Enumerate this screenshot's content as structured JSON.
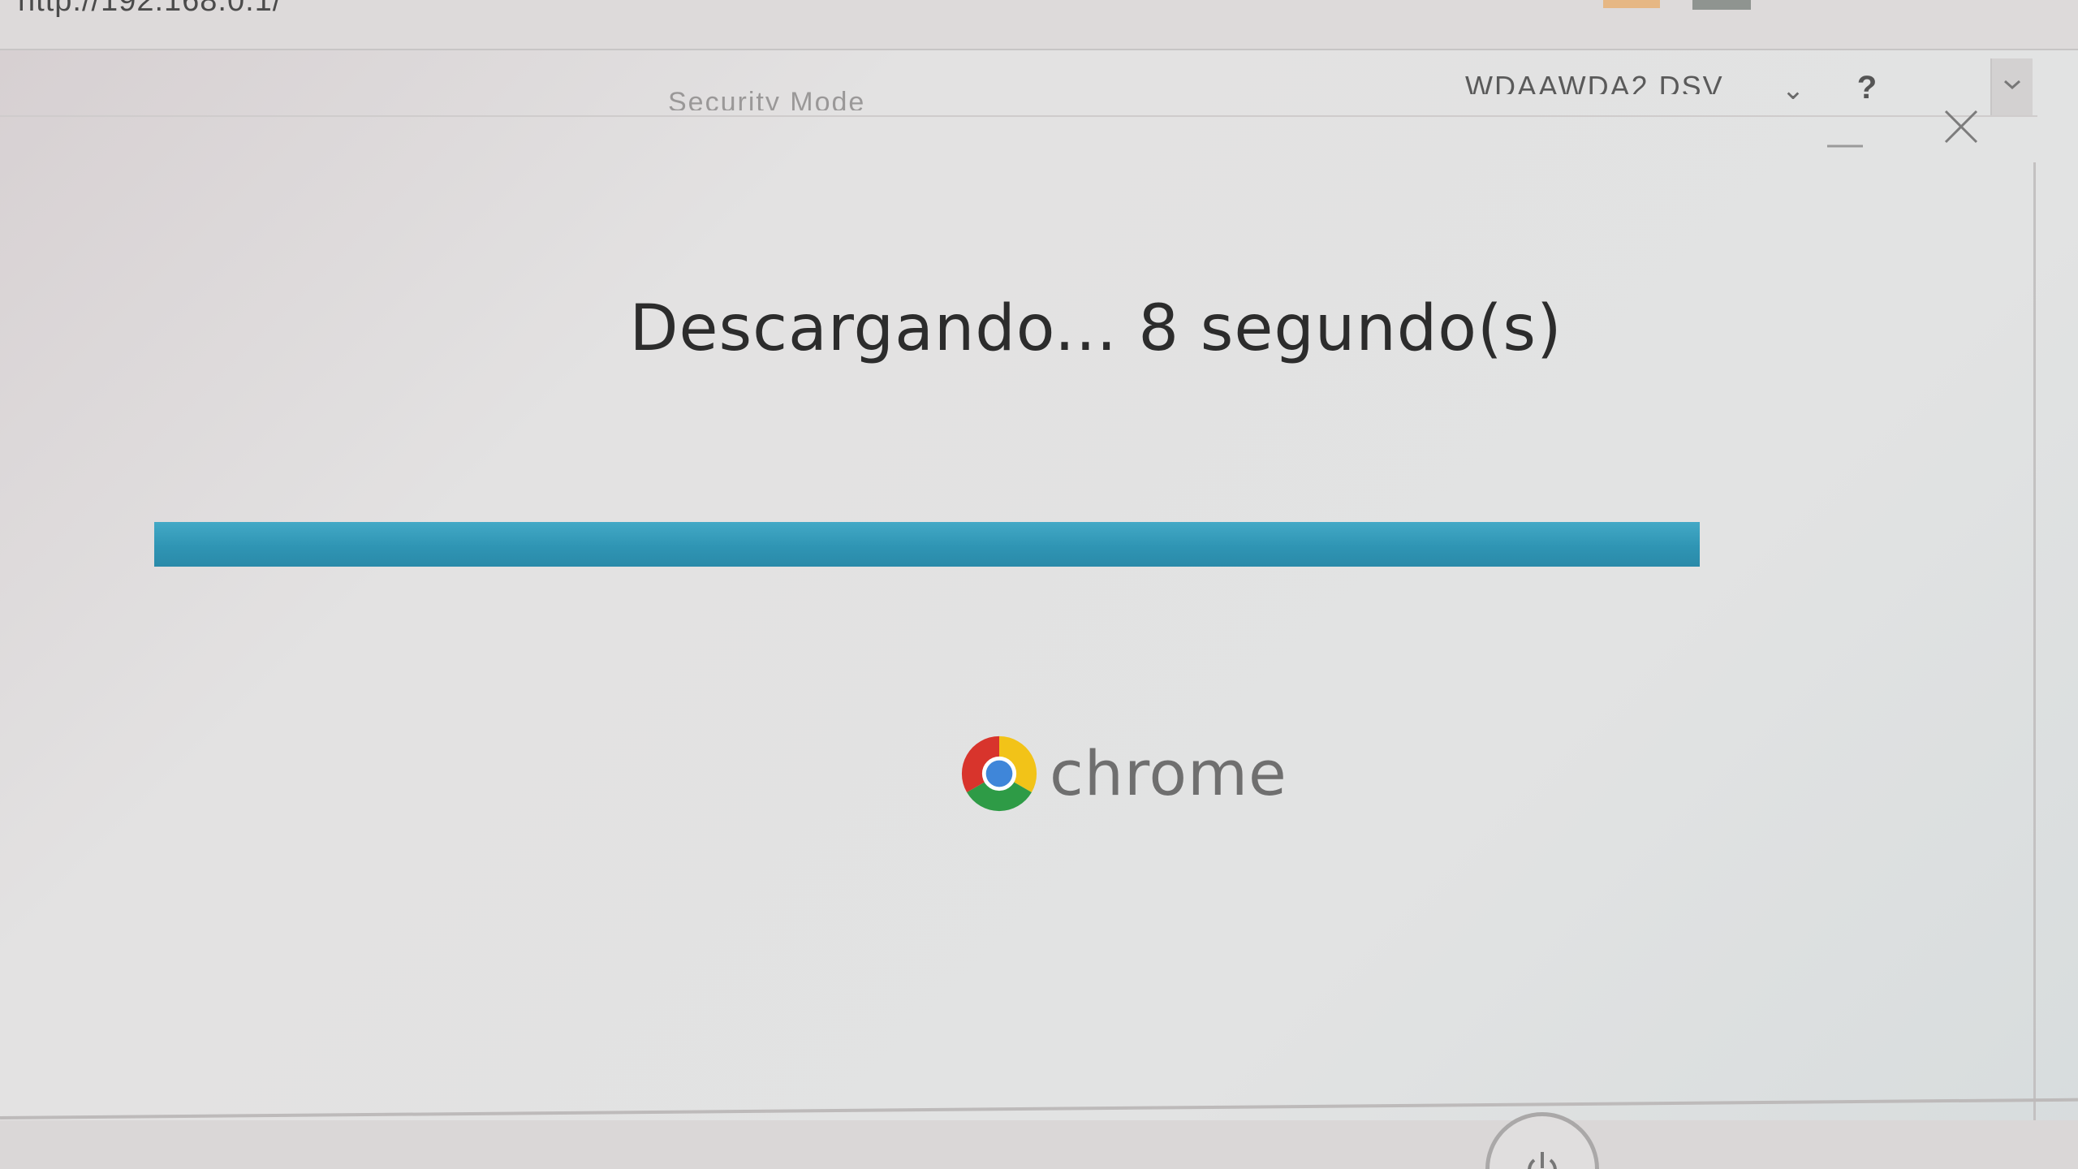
{
  "browser": {
    "url": "http://192.168.0.1/"
  },
  "header": {
    "security_mode_label": "Security Mode",
    "model_label": "WDAAWDA2 DSV",
    "help_label": "?"
  },
  "dialog": {
    "status_text": "Descargando... 8 segundo(s)",
    "progress_percent": 100,
    "brand_name": "chrome"
  },
  "colors": {
    "progress_bar": "#2f95b4",
    "text": "#2c2c2c",
    "brand_text": "#6f6f6f",
    "background": "#e2e2e2"
  },
  "icons": {
    "minimize": "minimize-icon",
    "close": "close-icon",
    "dropdown": "chevron-down-icon",
    "logo": "chrome-logo-icon",
    "power": "power-icon"
  }
}
